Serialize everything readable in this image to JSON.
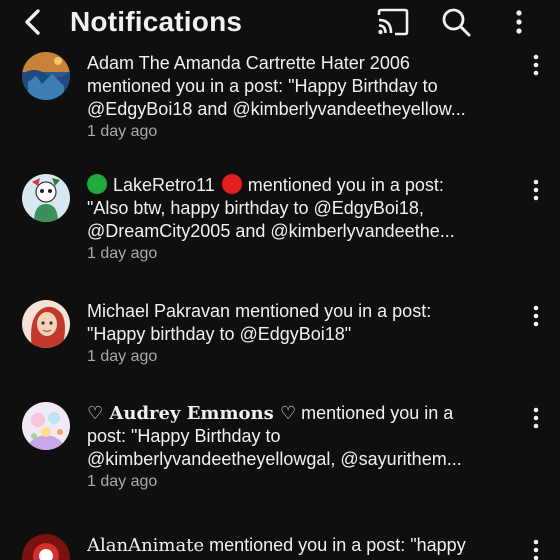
{
  "header": {
    "title": "Notifications",
    "icons": [
      "back-arrow-icon",
      "cast-icon",
      "search-icon",
      "more-vert-icon"
    ]
  },
  "notifications": [
    {
      "line1": "Adam The Amanda Cartrette Hater 2006",
      "line2": "mentioned you in a post: \"Happy Birthday to",
      "line3": "@EdgyBoi18 and @kimberlyvandeetheyellow...",
      "time": "1 day ago"
    },
    {
      "name": "LakeRetro11",
      "line1_suffix": "mentioned you in a post:",
      "line2": "\"Also btw, happy birthday to @EdgyBoi18,",
      "line3": "@DreamCity2005 and @kimberlyvandeethe...",
      "time": "1 day ago"
    },
    {
      "line1": "Michael Pakravan mentioned you in a post:",
      "line2": "\"Happy birthday to @EdgyBoi18\"",
      "time": "1 day ago"
    },
    {
      "name": "♡ Audrey Emmons ♡",
      "line1_suffix": " mentioned you in a",
      "line2": "post: \"Happy Birthday to",
      "line3": "@kimberlyvandeetheyellowgal, @sayurithem...",
      "time": "1 day ago"
    },
    {
      "name": "AlanAnimate",
      "line1_suffix": " mentioned you in a post: \"happy"
    }
  ]
}
